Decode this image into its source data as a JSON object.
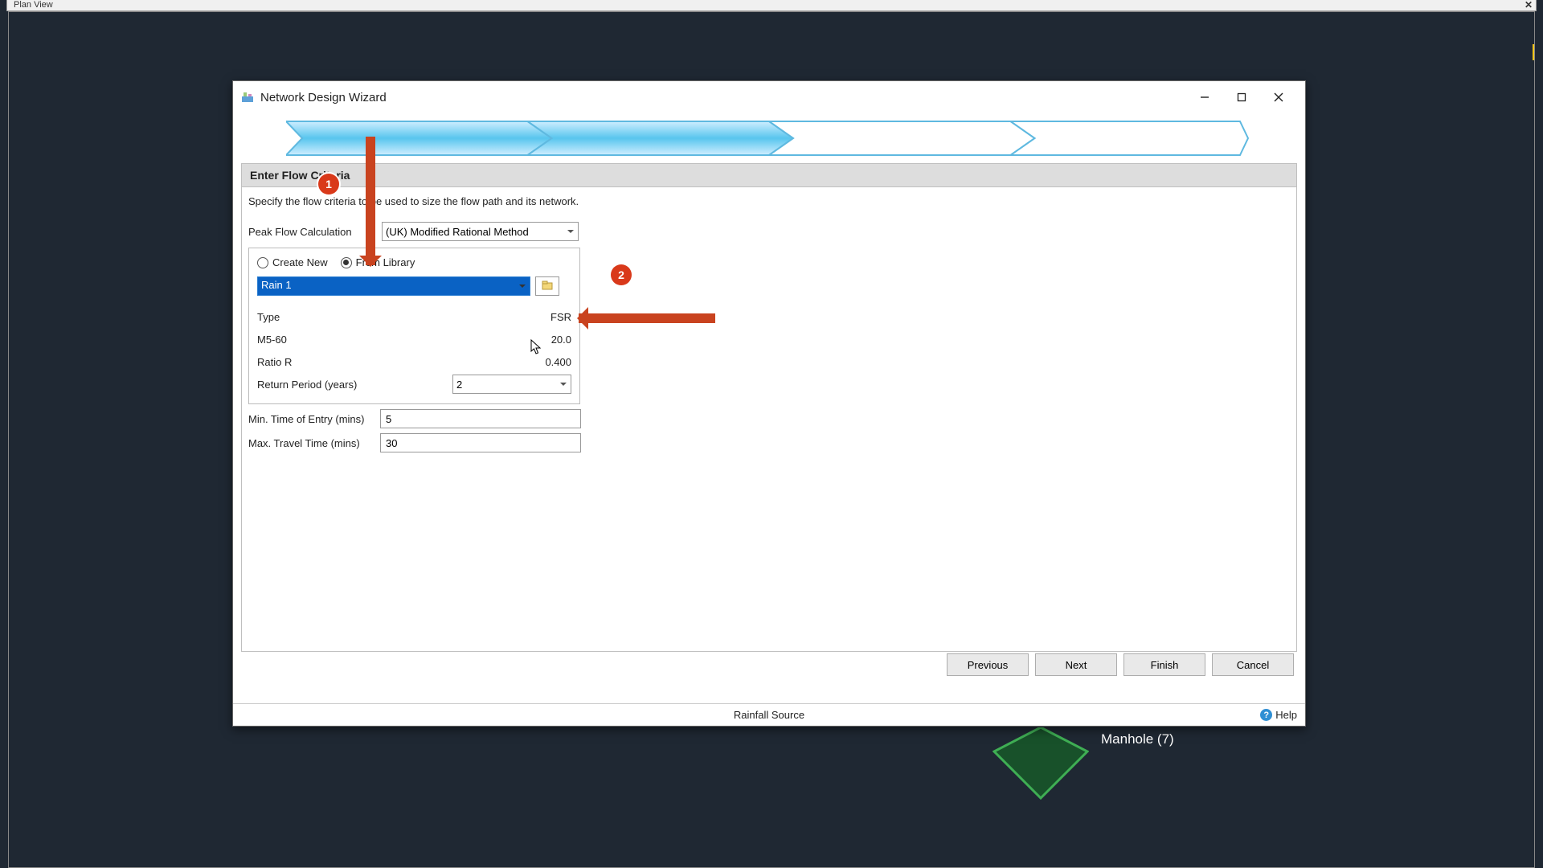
{
  "planview": {
    "title": "Plan View"
  },
  "wizard": {
    "title": "Network Design Wizard",
    "section_title": "Enter Flow Criteria",
    "description": "Specify the flow criteria to be used to size the flow path and its network.",
    "calc_label": "Peak Flow Calculation",
    "calc_value": "(UK) Modified Rational Method",
    "radio_create": "Create New",
    "radio_library": "From Library",
    "library_value": "Rain 1",
    "props": {
      "type_label": "Type",
      "type_value": "FSR",
      "m560_label": "M5-60",
      "m560_value": "20.0",
      "ratio_label": "Ratio R",
      "ratio_value": "0.400",
      "return_label": "Return Period (years)",
      "return_value": "2"
    },
    "min_entry_label": "Min. Time of Entry (mins)",
    "min_entry_value": "5",
    "max_travel_label": "Max. Travel Time (mins)",
    "max_travel_value": "30",
    "buttons": {
      "prev": "Previous",
      "next": "Next",
      "finish": "Finish",
      "cancel": "Cancel"
    },
    "statusbar_center": "Rainfall Source",
    "help_label": "Help"
  },
  "annotations": {
    "badge1": "1",
    "badge2": "2"
  },
  "overlay": {
    "manhole_label": "Manhole (7)"
  }
}
